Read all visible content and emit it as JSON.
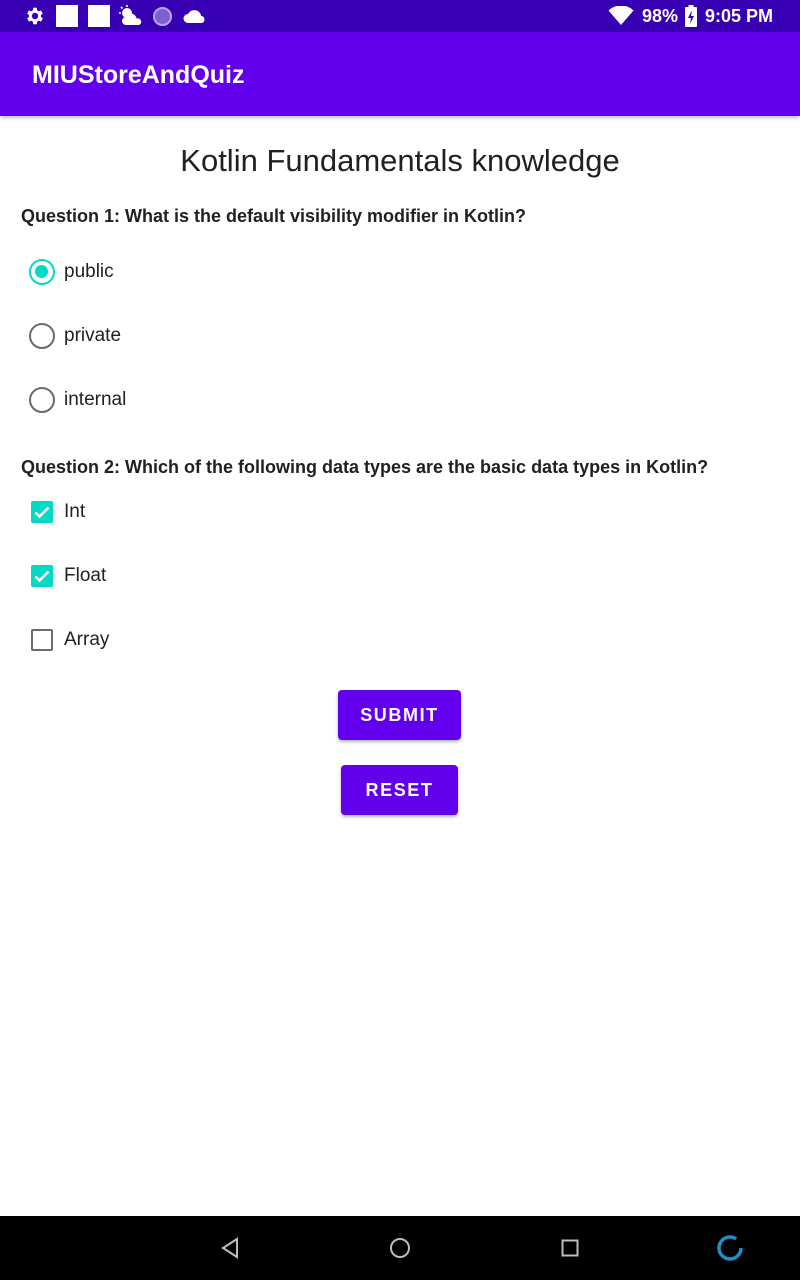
{
  "status_bar": {
    "battery": "98%",
    "time": "9:05 PM",
    "icons": [
      "settings-icon",
      "notification-square-icon",
      "notification-square-icon",
      "weather-icon",
      "moon-icon",
      "cloud-icon",
      "wifi-icon",
      "battery-charging-icon"
    ]
  },
  "app_bar": {
    "title": "MIUStoreAndQuiz"
  },
  "heading": "Kotlin Fundamentals knowledge",
  "question1": {
    "text": "Question 1: What is the default visibility modifier in Kotlin?",
    "options": [
      {
        "label": "public",
        "selected": true
      },
      {
        "label": "private",
        "selected": false
      },
      {
        "label": "internal",
        "selected": false
      }
    ]
  },
  "question2": {
    "text": "Question 2: Which of the following data types are the basic data types in Kotlin?",
    "options": [
      {
        "label": "Int",
        "checked": true
      },
      {
        "label": "Float",
        "checked": true
      },
      {
        "label": "Array",
        "checked": false
      }
    ]
  },
  "buttons": {
    "submit": "SUBMIT",
    "reset": "RESET"
  },
  "nav_bar": {
    "icons": [
      "back-icon",
      "home-icon",
      "recents-icon",
      "assistant-icon"
    ]
  },
  "colors": {
    "primary": "#6200ee",
    "primary_dark": "#3700b3",
    "accent": "#03dac5"
  }
}
